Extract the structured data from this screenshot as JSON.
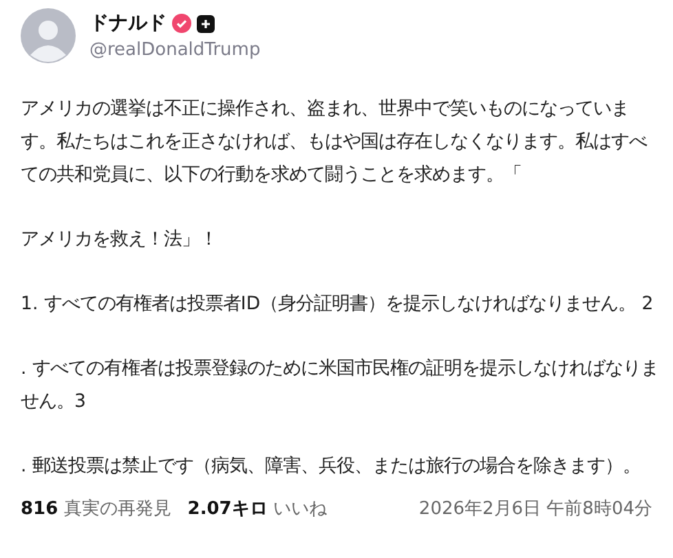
{
  "author": {
    "name": "ドナルド",
    "handle": "@realDonaldTrump",
    "verified": true
  },
  "paragraphs": [
    "アメリカの選挙は不正に操作され、盗まれ、世界中で笑いものになっています。私たちはこれを正さなければ、もはや国は存在しなくなります。私はすべての共和党員に、以下の行動を求めて闘うことを求めます。「",
    "アメリカを救え！法」！",
    "1. すべての有権者は投票者ID（身分証明書）を提示しなければなりません。 2",
    ". すべての有権者は投票登録のために米国市民権の証明を提示しなければなりません。3",
    ". 郵送投票は禁止です（病気、障害、兵役、または旅行の場合を除きます）。"
  ],
  "stats": [
    {
      "count": "816",
      "label": "真実の再発見"
    },
    {
      "count": "2.07キロ",
      "label": "いいね"
    }
  ],
  "timestamp": "2026年2月6日 午前8時04分"
}
